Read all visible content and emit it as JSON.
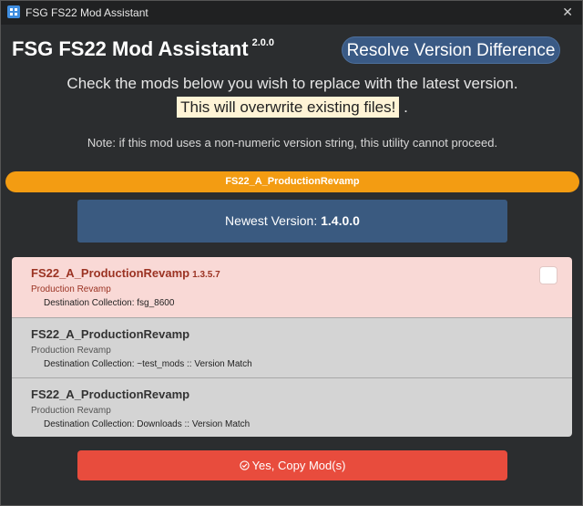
{
  "window": {
    "title": "FSG FS22 Mod Assistant",
    "close_glyph": "✕"
  },
  "header": {
    "title": "FSG FS22 Mod Assistant",
    "version": "2.0.0",
    "resolve_label": "Resolve Version Difference"
  },
  "instructions": {
    "line1": "Check the mods below you wish to replace with the latest version.",
    "warning": "This will overwrite existing files!",
    "warning_suffix": ".",
    "note": "Note: if this mod uses a non-numeric version string, this utility cannot proceed."
  },
  "mod_banner": "FS22_A_ProductionRevamp",
  "newest": {
    "label": "Newest Version:",
    "value": "1.4.0.0"
  },
  "mods": [
    {
      "name": "FS22_A_ProductionRevamp",
      "version": "1.3.5.7",
      "title": "Production Revamp",
      "destination": "Destination Collection: fsg_8600",
      "checked": false
    },
    {
      "name": "FS22_A_ProductionRevamp",
      "title": "Production Revamp",
      "destination": "Destination Collection: ~test_mods :: Version Match"
    },
    {
      "name": "FS22_A_ProductionRevamp",
      "title": "Production Revamp",
      "destination": "Destination Collection: Downloads :: Version Match"
    }
  ],
  "copy_button": {
    "label": "Yes, Copy Mod(s)",
    "icon": "check-circle-icon"
  },
  "colors": {
    "banner": "#f39c12",
    "newest_box": "#3a5a80",
    "outdated_row": "#f9d9d6",
    "matched_row": "#d4d4d4",
    "copy_button": "#e84c3d"
  }
}
